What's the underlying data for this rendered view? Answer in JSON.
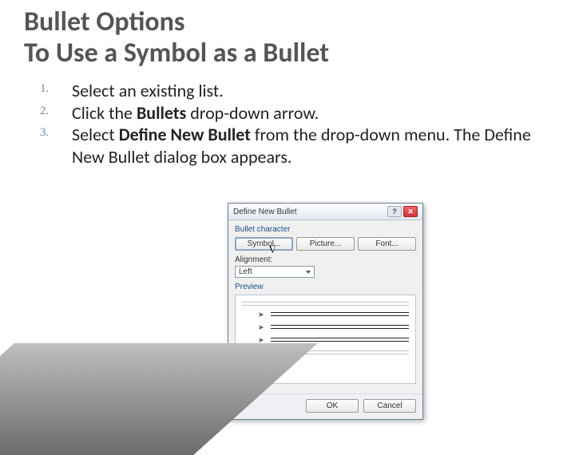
{
  "title_line1": "Bullet Options",
  "title_line2": "To Use a Symbol as a Bullet",
  "steps": {
    "s1": "Select an existing list.",
    "s2_a": "Click the ",
    "s2_b": "Bullets",
    "s2_c": " drop-down arrow.",
    "s3_a": "Select ",
    "s3_b": "Define New Bullet",
    "s3_c": " from the drop-down menu. The Define New Bullet dialog box appears."
  },
  "dialog": {
    "title": "Define New Bullet",
    "bullet_character_label": "Bullet character",
    "btn_symbol": "Symbol...",
    "btn_picture": "Picture...",
    "btn_font": "Font...",
    "alignment_label": "Alignment:",
    "alignment_value": "Left",
    "preview_label": "Preview",
    "ok": "OK",
    "cancel": "Cancel",
    "help_char": "?",
    "close_char": "✕"
  }
}
